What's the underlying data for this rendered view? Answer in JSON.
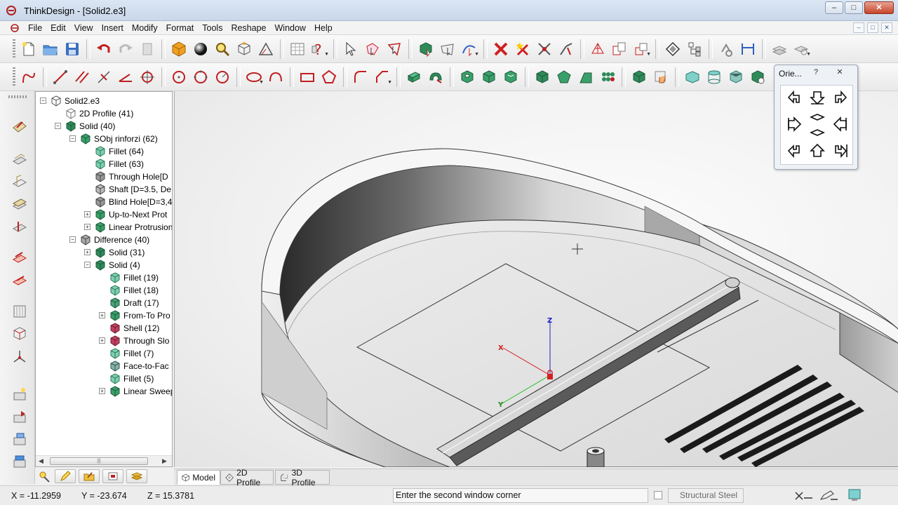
{
  "window": {
    "title": "ThinkDesign  - [Solid2.e3]",
    "minimize": "–",
    "maximize": "□",
    "close": "✕"
  },
  "menu": {
    "items": [
      "File",
      "Edit",
      "View",
      "Insert",
      "Modify",
      "Format",
      "Tools",
      "Reshape",
      "Window",
      "Help"
    ],
    "mdi": [
      "–",
      "□",
      "✕"
    ]
  },
  "tree": {
    "rows": [
      {
        "label": "Solid2.e3",
        "icon": "document-icon",
        "expander": "−"
      },
      {
        "label": "2D Profile (41)",
        "icon": "profile-2d-icon",
        "expander": ""
      },
      {
        "label": "Solid (40)",
        "icon": "solid-icon",
        "expander": "−"
      },
      {
        "label": "SObj  rinforzi (62)",
        "icon": "sobj-icon",
        "expander": "−"
      },
      {
        "label": "Fillet (64)",
        "icon": "fillet-icon",
        "expander": ""
      },
      {
        "label": "Fillet (63)",
        "icon": "fillet-icon",
        "expander": ""
      },
      {
        "label": "Through Hole[D",
        "icon": "hole-icon",
        "expander": ""
      },
      {
        "label": "Shaft [D=3.5, De",
        "icon": "shaft-icon",
        "expander": ""
      },
      {
        "label": "Blind Hole[D=3,4",
        "icon": "hole-icon",
        "expander": ""
      },
      {
        "label": "Up-to-Next Prot",
        "icon": "protrusion-icon",
        "expander": "+"
      },
      {
        "label": "Linear Protrusion",
        "icon": "protrusion-icon",
        "expander": "+"
      },
      {
        "label": "Difference (40)",
        "icon": "difference-icon",
        "expander": "−"
      },
      {
        "label": "Solid (31)",
        "icon": "solid-icon",
        "expander": "+"
      },
      {
        "label": "Solid (4)",
        "icon": "solid-icon",
        "expander": "−"
      },
      {
        "label": "Fillet (19)",
        "icon": "fillet-icon",
        "expander": ""
      },
      {
        "label": "Fillet (18)",
        "icon": "fillet-icon",
        "expander": ""
      },
      {
        "label": "Draft (17)",
        "icon": "draft-icon",
        "expander": ""
      },
      {
        "label": "From-To Pro",
        "icon": "protrusion-icon",
        "expander": "+"
      },
      {
        "label": "Shell (12)",
        "icon": "shell-icon",
        "expander": ""
      },
      {
        "label": "Through Slo",
        "icon": "slot-icon",
        "expander": "+"
      },
      {
        "label": "Fillet (7)",
        "icon": "fillet-icon",
        "expander": ""
      },
      {
        "label": "Face-to-Fac",
        "icon": "face-icon",
        "expander": ""
      },
      {
        "label": "Fillet (5)",
        "icon": "fillet-icon",
        "expander": ""
      },
      {
        "label": "Linear Sweep",
        "icon": "sweep-icon",
        "expander": "+"
      }
    ]
  },
  "orientation": {
    "title": "Orie...",
    "help": "?",
    "close": "✕",
    "buttons": [
      "top-left-view",
      "front-view",
      "top-right-view",
      "left-view",
      "top-bottom-view",
      "right-view",
      "bottom-left-view",
      "back-view",
      "bottom-right-view"
    ]
  },
  "axes": {
    "x": "X",
    "y": "Y",
    "z": "Z"
  },
  "tabs": [
    "Model",
    "2D Profile",
    "3D Profile"
  ],
  "status": {
    "x": "X = -11.2959",
    "y": "Y = -23.674",
    "z": "Z = 15.3781",
    "message": "Enter the second window corner",
    "material": "Structural Steel"
  },
  "colors": {
    "accent": "#2f7f9a",
    "solid_green": "#3a8f6a",
    "axis_x": "#d42020",
    "axis_y": "#20c020",
    "axis_z": "#2020c8"
  }
}
